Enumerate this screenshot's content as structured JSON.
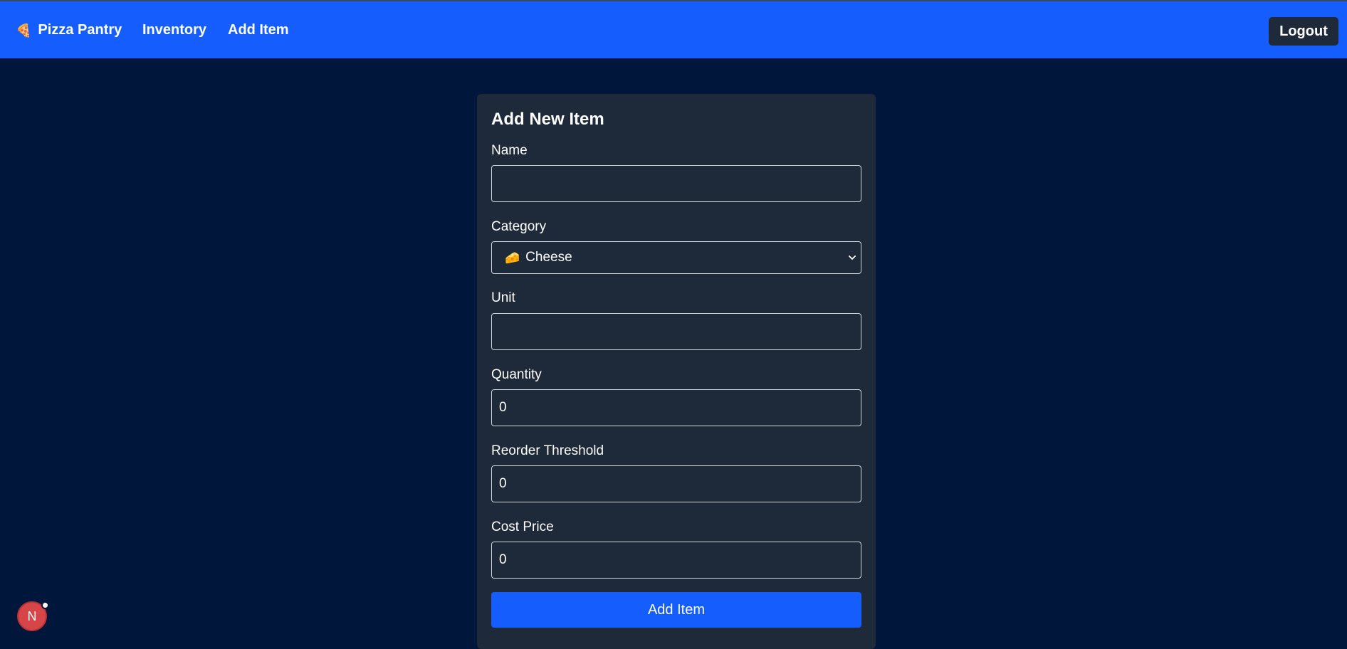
{
  "nav": {
    "brand_icon": "🍕",
    "brand": "Pizza Pantry",
    "links": [
      "Inventory",
      "Add Item"
    ],
    "logout": "Logout"
  },
  "form": {
    "title": "Add New Item",
    "name": {
      "label": "Name",
      "value": ""
    },
    "category": {
      "label": "Category",
      "selected_icon": "🧀",
      "selected": "Cheese"
    },
    "unit": {
      "label": "Unit",
      "value": ""
    },
    "quantity": {
      "label": "Quantity",
      "value": "0"
    },
    "reorder_threshold": {
      "label": "Reorder Threshold",
      "value": "0"
    },
    "cost_price": {
      "label": "Cost Price",
      "value": "0"
    },
    "submit": "Add Item"
  },
  "dev_indicator": {
    "letter": "N"
  },
  "colors": {
    "nav_bg": "#155dfc",
    "page_bg": "#00163a",
    "card_bg": "#1e2939",
    "button_bg": "#155dfc"
  }
}
